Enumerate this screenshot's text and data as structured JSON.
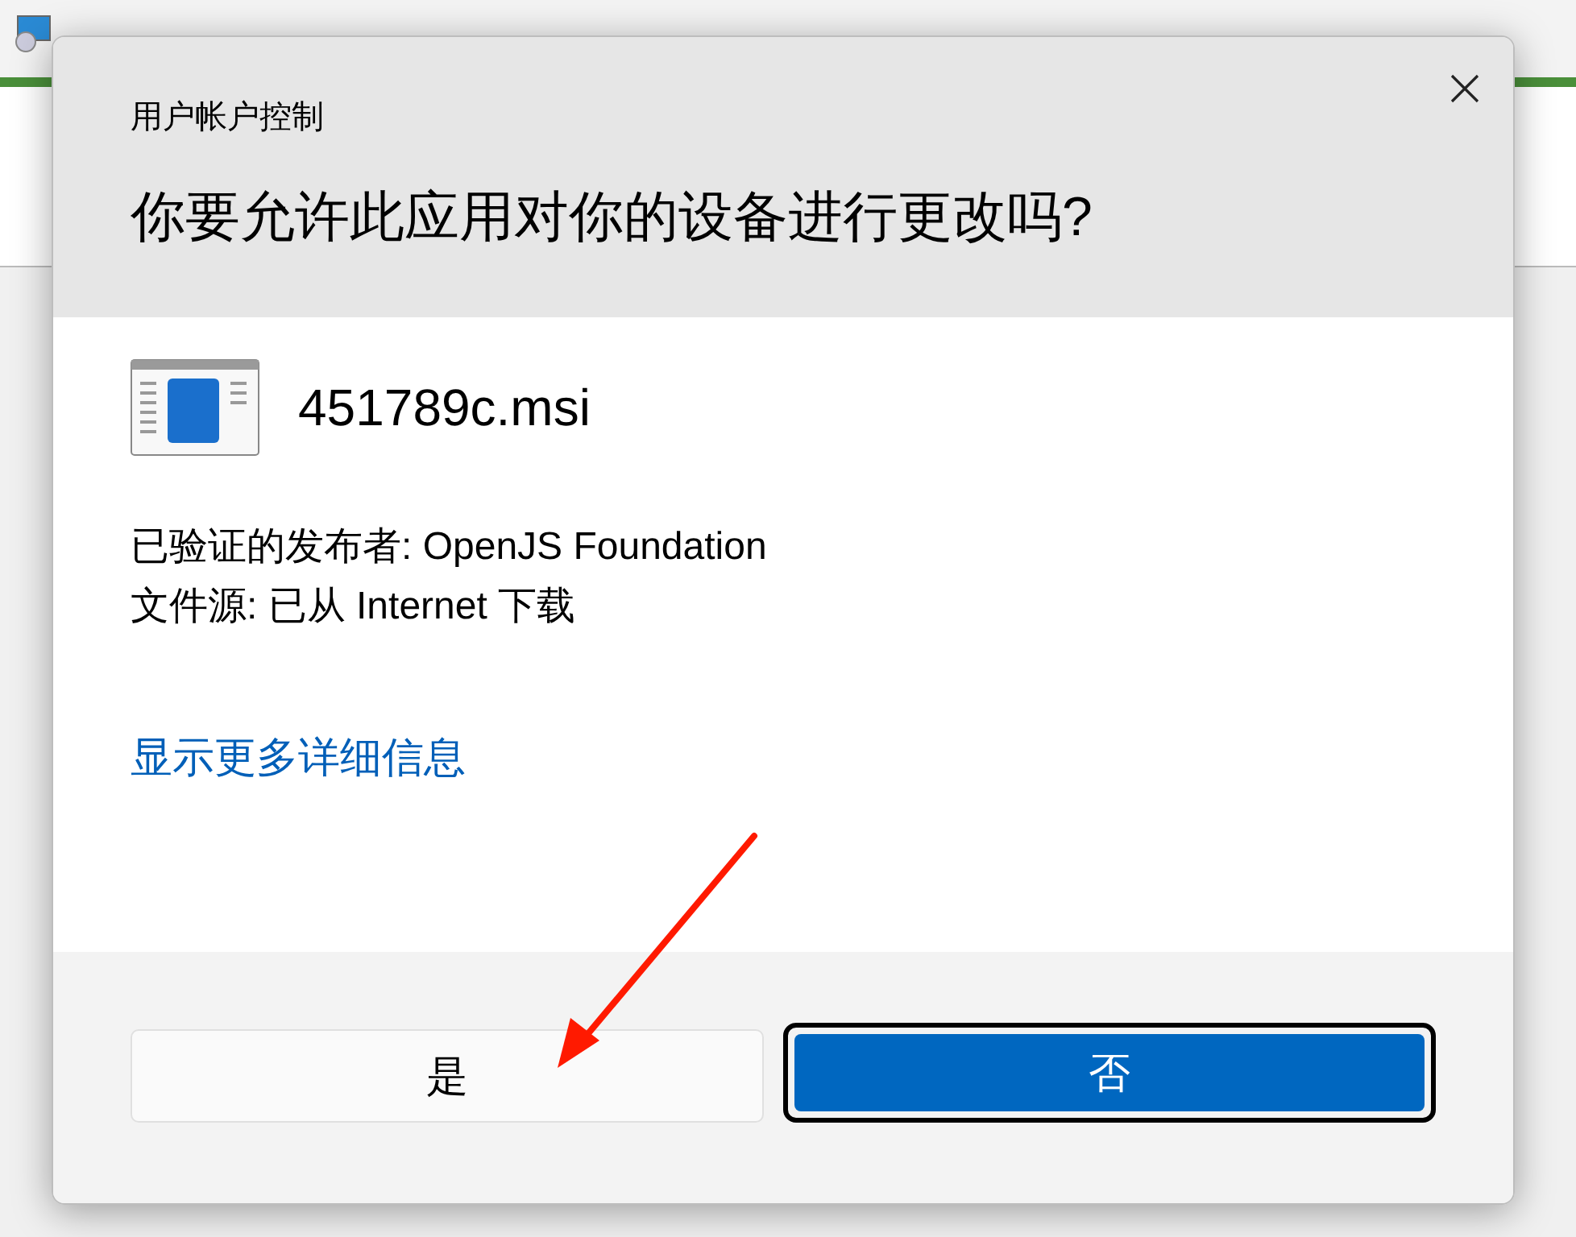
{
  "dialog": {
    "title": "用户帐户控制",
    "question": "你要允许此应用对你的设备进行更改吗?",
    "app_name": "451789c.msi",
    "details": [
      "已验证的发布者: OpenJS Foundation",
      "文件源: 已从 Internet 下载"
    ],
    "more_link": "显示更多详细信息",
    "buttons": [
      {
        "label": "是",
        "selected": false
      },
      {
        "label": "否",
        "selected": true
      }
    ]
  }
}
